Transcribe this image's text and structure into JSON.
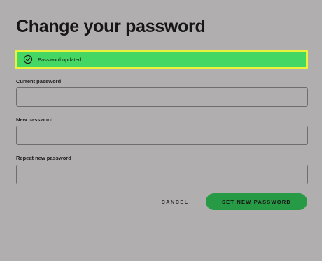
{
  "page": {
    "title": "Change your password"
  },
  "alert": {
    "icon": "check-circle-icon",
    "message": "Password updated",
    "background_color": "#45d764",
    "border_color": "#eaf23a"
  },
  "form": {
    "current_password": {
      "label": "Current password",
      "value": ""
    },
    "new_password": {
      "label": "New password",
      "value": ""
    },
    "repeat_password": {
      "label": "Repeat new password",
      "value": ""
    }
  },
  "actions": {
    "cancel_label": "CANCEL",
    "submit_label": "SET NEW PASSWORD",
    "submit_color": "#269a45"
  }
}
